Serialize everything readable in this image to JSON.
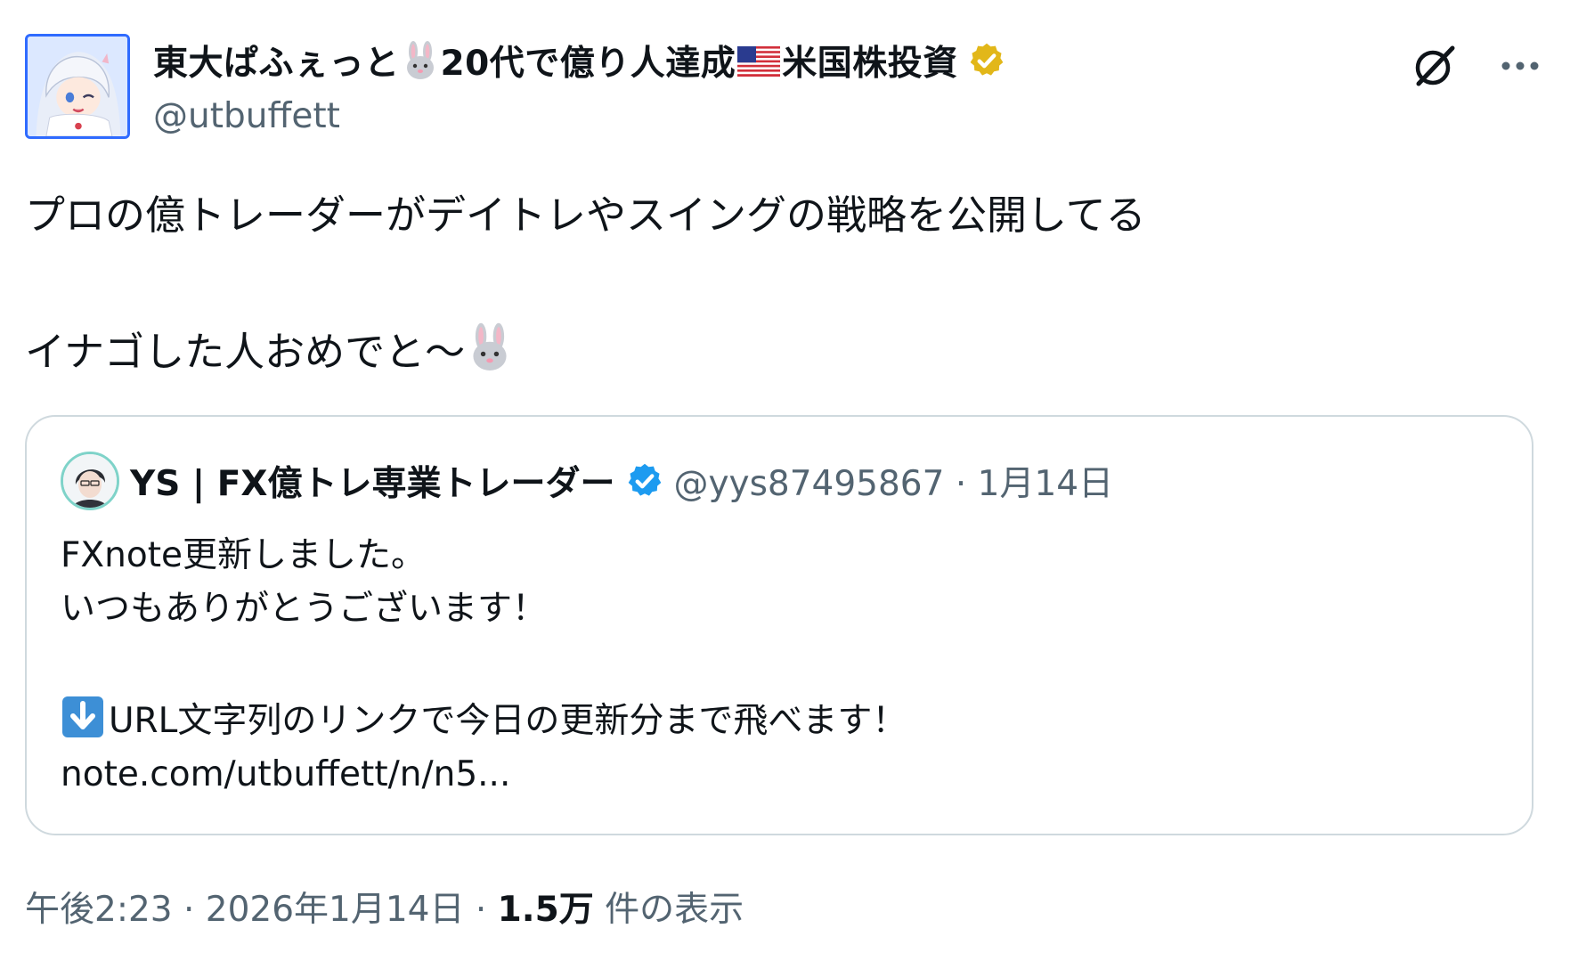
{
  "author": {
    "display_name_part1": "東大ぱふぇっと",
    "display_name_part2": "20代で億り人達成",
    "display_name_part3": "米国株投資",
    "handle": "@utbuffett"
  },
  "tweet": {
    "line1": "プロの億トレーダーがデイトレやスイングの戦略を公開してる",
    "line2": "イナゴした人おめでと〜"
  },
  "quote": {
    "name": "YS | FX億トレ専業トレーダー",
    "handle_and_date": "@yys87495867 · 1月14日",
    "line1": "FXnote更新しました。",
    "line2": "いつもありがとうございます！",
    "line3": "URL文字列のリンクで今日の更新分まで飛べます！",
    "line4": "note.com/utbuffett/n/n5..."
  },
  "footer": {
    "time_date": "午後2:23 · 2026年1月14日 · ",
    "views_count": "1.5万",
    "views_label": " 件の表示"
  },
  "icons": {
    "rabbit": "rabbit-face-emoji",
    "flag": "us-flag-emoji",
    "gold_badge": "verified-gold-badge",
    "blue_badge": "verified-blue-badge",
    "grok": "grok-icon",
    "more": "more-icon",
    "down_arrow": "down-arrow-emoji"
  },
  "colors": {
    "text_primary": "#0f1419",
    "text_secondary": "#536471",
    "border": "#cfd9de",
    "verified_blue": "#1d9bf0",
    "verified_gold": "#e2b719"
  }
}
